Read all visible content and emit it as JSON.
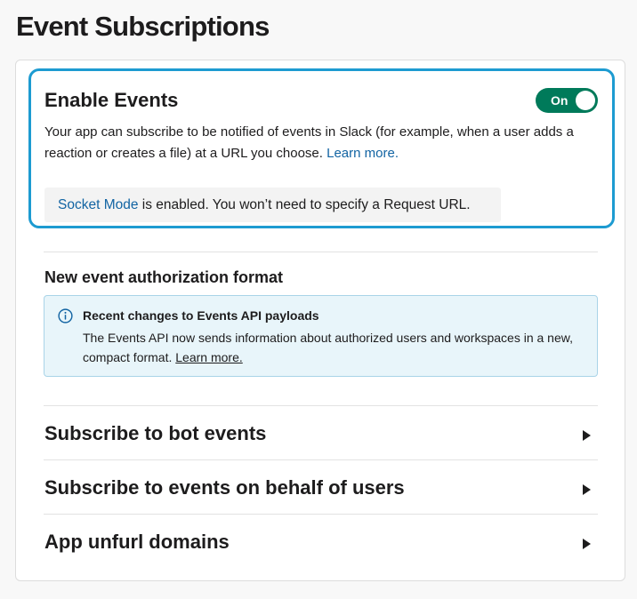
{
  "page": {
    "title": "Event Subscriptions"
  },
  "enable_events": {
    "title": "Enable Events",
    "toggle_label": "On",
    "toggle_state": "on",
    "description": "Your app can subscribe to be notified of events in Slack (for example, when a user adds a reaction or creates a file) at a URL you choose.",
    "learn_more": "Learn more.",
    "socket_link": "Socket Mode",
    "socket_text": " is enabled. You won’t need to specify a Request URL."
  },
  "auth_format": {
    "title": "New event authorization format",
    "info_title": "Recent changes to Events API payloads",
    "info_body": "The Events API now sends information about authorized users and workspaces in a new, compact format.",
    "info_link": "Learn more."
  },
  "sections": [
    {
      "label": "Subscribe to bot events",
      "icon": "caret-right-icon"
    },
    {
      "label": "Subscribe to events on behalf of users",
      "icon": "caret-right-icon"
    },
    {
      "label": "App unfurl domains",
      "icon": "caret-right-icon"
    }
  ],
  "colors": {
    "toggle_on": "#007a5a",
    "highlight_border": "#1d9bd1",
    "link": "#1264a3",
    "info_bg": "#e8f5fa",
    "info_border": "#a9d4e8"
  }
}
